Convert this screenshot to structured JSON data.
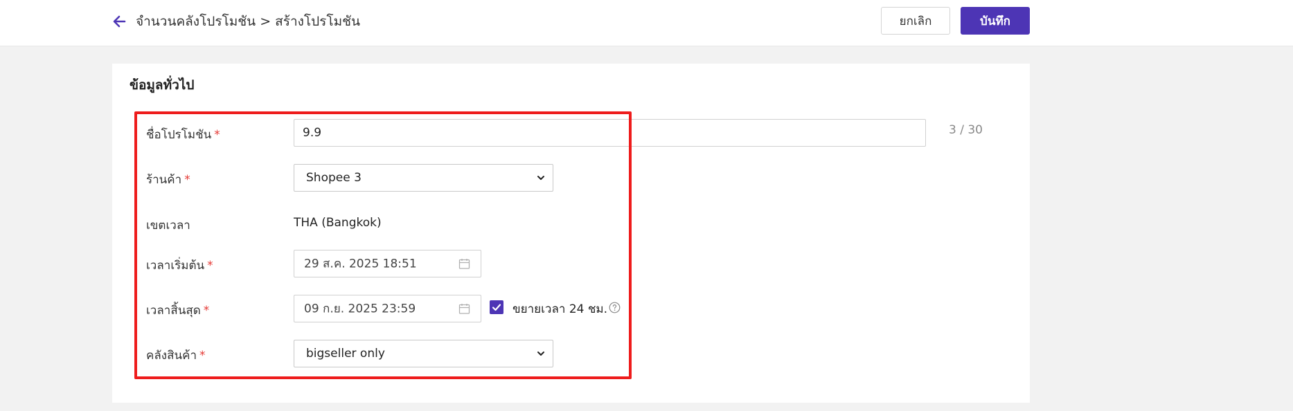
{
  "header": {
    "breadcrumb": "จำนวนคลังโปรโมชัน > สร้างโปรโมชัน",
    "cancel_label": "ยกเลิก",
    "save_label": "บันทึก",
    "accent_color": "#4d35b5"
  },
  "section": {
    "title": "ข้อมูลทั่วไป"
  },
  "form": {
    "promo_name": {
      "label": "ชื่อโปรโมชัน",
      "required_mark": "*",
      "value": "9.9",
      "counter": "3 / 30"
    },
    "shop": {
      "label": "ร้านค้า",
      "required_mark": "*",
      "value": "Shopee 3"
    },
    "timezone": {
      "label": "เขตเวลา",
      "value": "THA (Bangkok)"
    },
    "start_time": {
      "label": "เวลาเริ่มต้น",
      "required_mark": "*",
      "value": "29 ส.ค. 2025 18:51"
    },
    "end_time": {
      "label": "เวลาสิ้นสุด",
      "required_mark": "*",
      "value": "09 ก.ย. 2025 23:59"
    },
    "extend": {
      "label": "ขยายเวลา 24 ชม.",
      "checked": true
    },
    "warehouse": {
      "label": "คลังสินค้า",
      "required_mark": "*",
      "value": "bigseller only"
    }
  },
  "icons": {
    "back": "arrow-left-icon",
    "calendar": "calendar-icon",
    "chevron": "chevron-down-icon",
    "check": "checkmark-icon",
    "help": "question-circle-icon"
  },
  "highlight_color": "#ee1c1c"
}
